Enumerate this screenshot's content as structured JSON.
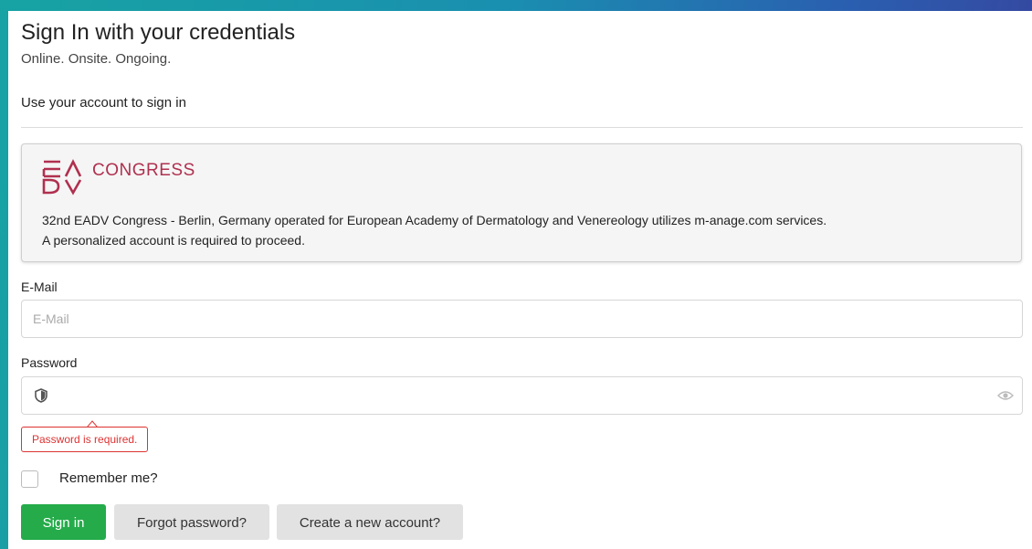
{
  "header": {
    "title": "Sign In with your credentials",
    "subtitle": "Online. Onsite. Ongoing.",
    "lead": "Use your account to sign in"
  },
  "event": {
    "logo_text": "CONGRESS",
    "description_line1": "32nd EADV Congress - Berlin, Germany operated for European Academy of Dermatology and Venereology utilizes m-anage.com services.",
    "description_line2": "A personalized account is required to proceed."
  },
  "form": {
    "email_label": "E-Mail",
    "email_placeholder": "E-Mail",
    "email_value": "",
    "password_label": "Password",
    "password_value": "",
    "password_error": "Password is required.",
    "remember_label": "Remember me?",
    "remember_checked": false
  },
  "actions": {
    "signin_label": "Sign in",
    "forgot_label": "Forgot password?",
    "create_label": "Create a new account?"
  },
  "colors": {
    "brand": "#b0304f",
    "primary_button": "#25ab4a",
    "error": "#dd3333"
  }
}
